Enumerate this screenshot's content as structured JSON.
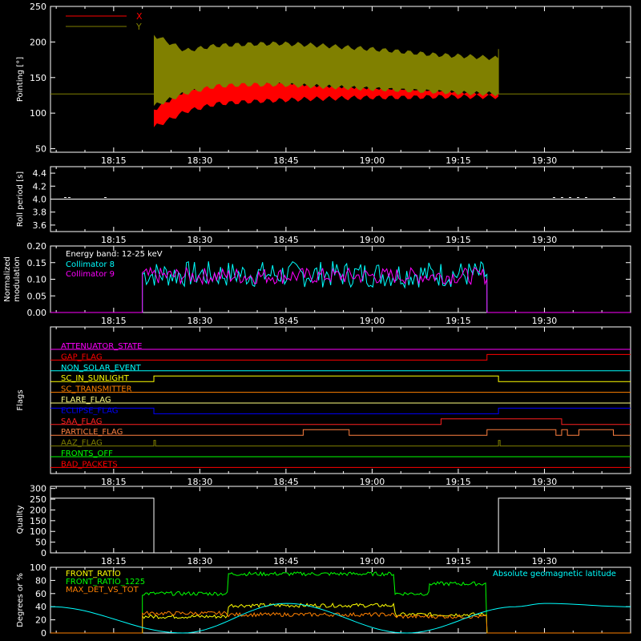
{
  "figure": {
    "time_ticks": [
      "18:15",
      "18:30",
      "18:45",
      "19:00",
      "19:15",
      "19:30"
    ]
  },
  "chart_data": [
    {
      "type": "line",
      "ylabel": "Pointing [°]",
      "ylim": [
        45,
        250
      ],
      "yticks": [
        "250",
        "200",
        "150",
        "100",
        "50"
      ],
      "legend": [
        {
          "name": "X",
          "color": "#ff0000"
        },
        {
          "name": "Y",
          "color": "#808000"
        }
      ],
      "series": [
        {
          "name": "X",
          "color": "#ff0000",
          "band": {
            "start": "18:22",
            "end": "19:22",
            "upper": [
              105,
              132,
              145,
              146,
              145,
              140,
              138,
              136,
              135,
              133,
              130,
              128
            ],
            "lower": [
              80,
              102,
              113,
              116,
              118,
              120,
              121,
              122,
              122,
              123,
              123,
              123
            ]
          }
        },
        {
          "name": "Y",
          "color": "#808000",
          "band": {
            "start": "18:22",
            "end": "19:22",
            "upper": [
              210,
              188,
              195,
              197,
              198,
              196,
              193,
              190,
              186,
              182,
              180,
              177
            ],
            "lower": [
              110,
              128,
              138,
              140,
              140,
              138,
              136,
              134,
              132,
              130,
              128,
              127
            ]
          }
        }
      ],
      "baseline": 127
    },
    {
      "type": "line",
      "ylabel": "Roll period [s]",
      "ylim": [
        3.5,
        4.5
      ],
      "yticks": [
        "4.4",
        "4.2",
        "4.0",
        "3.8",
        "3.6"
      ],
      "series": [
        {
          "name": "",
          "color": "#ffffff",
          "constant": 4.0
        }
      ]
    },
    {
      "type": "line",
      "ylabel": "Normalized\nmodulation",
      "ylim": [
        0,
        0.2
      ],
      "yticks": [
        "0.20",
        "0.15",
        "0.10",
        "0.05",
        "0.00"
      ],
      "annotation": "Energy band: 12-25 keV",
      "legend": [
        {
          "name": "Collimator 8",
          "color": "#00ffff"
        },
        {
          "name": "Collimator 9",
          "color": "#ff00ff"
        }
      ],
      "series": [
        {
          "name": "Collimator 8",
          "color": "#00ffff",
          "start": "18:20",
          "end": "19:20",
          "mean": 0.115,
          "spread": 0.04
        },
        {
          "name": "Collimator 9",
          "color": "#ff00ff",
          "start": "18:20",
          "end": "19:20",
          "mean": 0.11,
          "spread": 0.025
        }
      ]
    },
    {
      "type": "line",
      "ylabel": "Flags",
      "flags": [
        {
          "name": "ATTENUATOR_STATE",
          "color": "#ff00ff",
          "segments": []
        },
        {
          "name": "GAP_FLAG",
          "color": "#ff0000",
          "segments": [
            [
              "19:20",
              "end"
            ]
          ]
        },
        {
          "name": "NON_SOLAR_EVENT",
          "color": "#00ffff",
          "segments": []
        },
        {
          "name": "SC_IN_SUNLIGHT",
          "color": "#ffff00",
          "segments": [
            [
              "18:22",
              "19:22"
            ]
          ]
        },
        {
          "name": "SC_TRANSMITTER",
          "color": "#ff8000",
          "segments": []
        },
        {
          "name": "FLARE_FLAG",
          "color": "#ffff80",
          "segments": []
        },
        {
          "name": "ECLIPSE_FLAG",
          "color": "#0000ff",
          "segments": [
            [
              "start",
              "18:22"
            ],
            [
              "19:22",
              "end"
            ]
          ]
        },
        {
          "name": "SAA_FLAG",
          "color": "#ff2020",
          "segments": [
            [
              "19:12",
              "19:33"
            ]
          ]
        },
        {
          "name": "PARTICLE_FLAG",
          "color": "#ff8040",
          "segments": [
            [
              "18:48",
              "18:56"
            ],
            [
              "19:20",
              "19:32"
            ],
            [
              "19:33",
              "19:34"
            ],
            [
              "19:36",
              "19:42"
            ]
          ]
        },
        {
          "name": "AAZ_FLAG",
          "color": "#808000",
          "segments": [
            [
              "18:22",
              "18:22"
            ],
            [
              "19:22",
              "19:22"
            ]
          ]
        },
        {
          "name": "FRONTS_OFF",
          "color": "#00ff00",
          "segments": []
        },
        {
          "name": "BAD_PACKETS",
          "color": "#ff0000",
          "segments": []
        }
      ]
    },
    {
      "type": "line",
      "ylabel": "Quality",
      "ylim": [
        0,
        310
      ],
      "yticks": [
        "300",
        "250",
        "200",
        "150",
        "100",
        "50",
        "0"
      ],
      "series": [
        {
          "name": "",
          "color": "#ffffff",
          "steps": [
            [
              "start",
              "18:22",
              255
            ],
            [
              "18:22",
              "19:22",
              0
            ],
            [
              "19:22",
              "end",
              255
            ]
          ]
        }
      ]
    },
    {
      "type": "line",
      "ylabel": "Degrees or %",
      "ylim": [
        0,
        100
      ],
      "yticks": [
        "100",
        "80",
        "60",
        "40",
        "20",
        "0"
      ],
      "legend": [
        {
          "name": "FRONT_RATIO",
          "color": "#ffff00"
        },
        {
          "name": "FRONT_RATIO_1225",
          "color": "#00ff00"
        },
        {
          "name": "MAX_DET_VS_TOT",
          "color": "#ff8000"
        }
      ],
      "annotation": "Absolute geomagnetic latitude",
      "annotation_color": "#00ffff",
      "series": [
        {
          "name": "FRONT_RATIO",
          "color": "#ffff00",
          "steps": [
            [
              "18:20",
              "18:35",
              25
            ],
            [
              "18:35",
              "19:04",
              42
            ],
            [
              "19:04",
              "19:20",
              28
            ]
          ]
        },
        {
          "name": "FRONT_RATIO_1225",
          "color": "#00ff00",
          "steps": [
            [
              "18:20",
              "18:35",
              60
            ],
            [
              "18:35",
              "19:04",
              90
            ],
            [
              "19:04",
              "19:10",
              60
            ],
            [
              "19:10",
              "19:20",
              75
            ]
          ]
        },
        {
          "name": "MAX_DET_VS_TOT",
          "color": "#ff8000",
          "steps": [
            [
              "18:20",
              "18:35",
              30
            ],
            [
              "18:35",
              "19:04",
              28
            ],
            [
              "19:04",
              "19:20",
              25
            ]
          ]
        },
        {
          "name": "Absolute geomagnetic latitude",
          "color": "#00ffff",
          "points": [
            [
              "start",
              40
            ],
            [
              "18:27",
              0
            ],
            [
              "18:45",
              45
            ],
            [
              "19:06",
              0
            ],
            [
              "19:25",
              40
            ],
            [
              "19:30",
              45
            ],
            [
              "end",
              40
            ]
          ]
        }
      ]
    }
  ]
}
